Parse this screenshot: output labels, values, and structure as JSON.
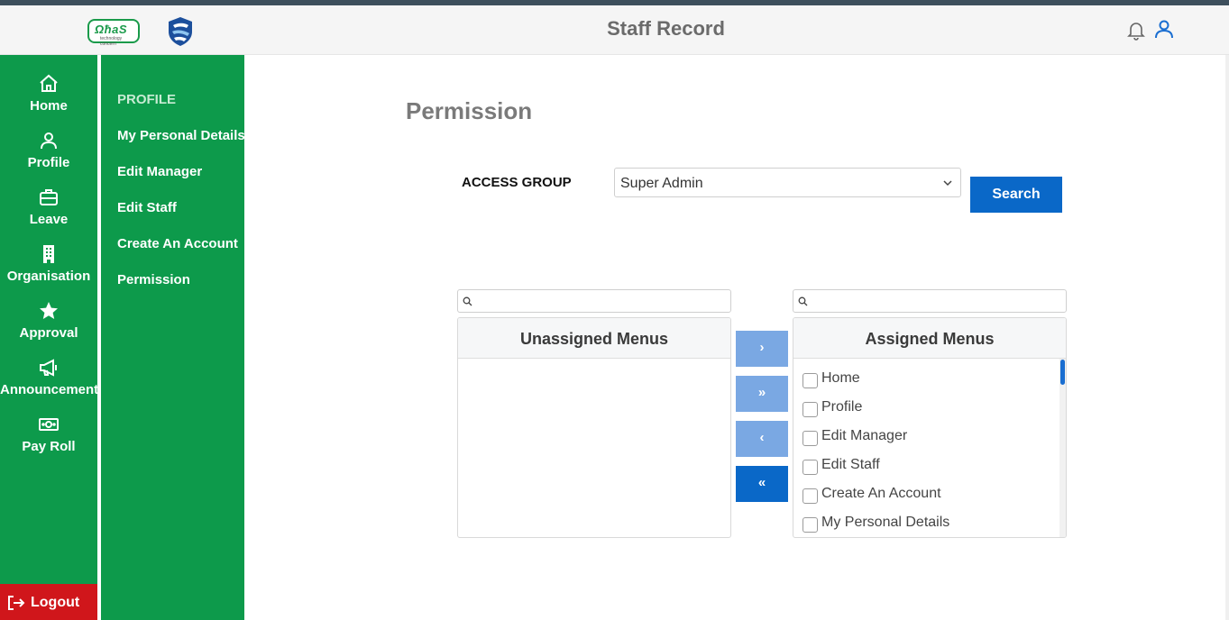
{
  "header": {
    "title": "Staff Record",
    "logo_text": "ΩħaS",
    "logo_subtext": "technology concern",
    "brand_color": "#0d9a4b"
  },
  "sidebar": {
    "items": [
      {
        "label": "Home",
        "icon": "home-icon"
      },
      {
        "label": "Profile",
        "icon": "user-icon"
      },
      {
        "label": "Leave",
        "icon": "briefcase-icon"
      },
      {
        "label": "Organisation",
        "icon": "building-icon"
      },
      {
        "label": "Approval",
        "icon": "star-icon"
      },
      {
        "label": "Announcement",
        "icon": "megaphone-icon"
      },
      {
        "label": "Pay Roll",
        "icon": "money-icon"
      }
    ],
    "logout_label": "Logout",
    "logout_color": "#d0161b"
  },
  "subnav": {
    "heading": "PROFILE",
    "items": [
      "My Personal Details",
      "Edit Manager",
      "Edit Staff",
      "Create An Account",
      "Permission"
    ]
  },
  "main": {
    "title": "Permission",
    "access_group_label": "ACCESS GROUP",
    "access_group_value": "Super Admin",
    "search_label": "Search",
    "unassigned_title": "Unassigned Menus",
    "assigned_title": "Assigned Menus",
    "move_buttons": [
      "›",
      "»",
      "‹",
      "«"
    ],
    "assigned_items": [
      "Home",
      "Profile",
      "Edit Manager",
      "Edit Staff",
      "Create An Account",
      "My Personal Details"
    ]
  }
}
